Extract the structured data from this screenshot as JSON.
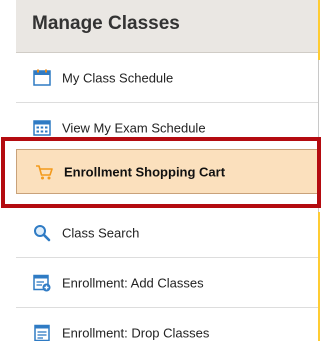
{
  "header": {
    "title": "Manage Classes"
  },
  "menu": {
    "items": [
      {
        "label": "My Class Schedule",
        "icon": "calendar-icon"
      },
      {
        "label": "View My Exam Schedule",
        "icon": "exam-calendar-icon"
      },
      {
        "label": "Enrollment Shopping Cart",
        "icon": "shopping-cart-icon",
        "active": true
      },
      {
        "label": "Class Search",
        "icon": "search-icon"
      },
      {
        "label": "Enrollment:  Add Classes",
        "icon": "add-classes-icon"
      },
      {
        "label": "Enrollment:  Drop Classes",
        "icon": "drop-classes-icon"
      }
    ]
  },
  "colors": {
    "header_bg": "#eae7e3",
    "active_bg": "#fbe0bd",
    "highlight_border": "#b40b10",
    "icon_blue": "#2f7bc4",
    "cart_orange": "#f39a1c"
  }
}
